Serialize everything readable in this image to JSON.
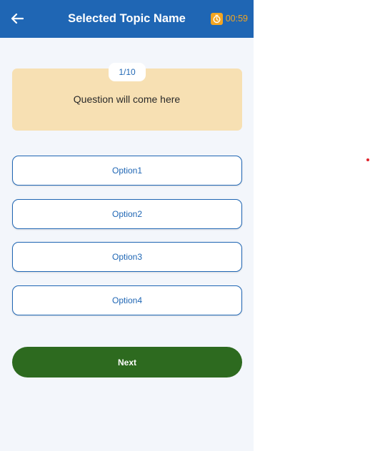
{
  "header": {
    "title": "Selected Topic Name",
    "timer": "00:59",
    "back_icon": "arrow-left-icon",
    "timer_icon": "stopwatch-icon"
  },
  "question": {
    "counter": "1/10",
    "text": "Question will come here"
  },
  "options": [
    {
      "label": "Option1"
    },
    {
      "label": "Option2"
    },
    {
      "label": "Option3"
    },
    {
      "label": "Option4"
    }
  ],
  "next_label": "Next",
  "colors": {
    "primary": "#1f66b4",
    "accent": "#f3a521",
    "card": "#f7e0b3",
    "next": "#2d6a1f"
  }
}
